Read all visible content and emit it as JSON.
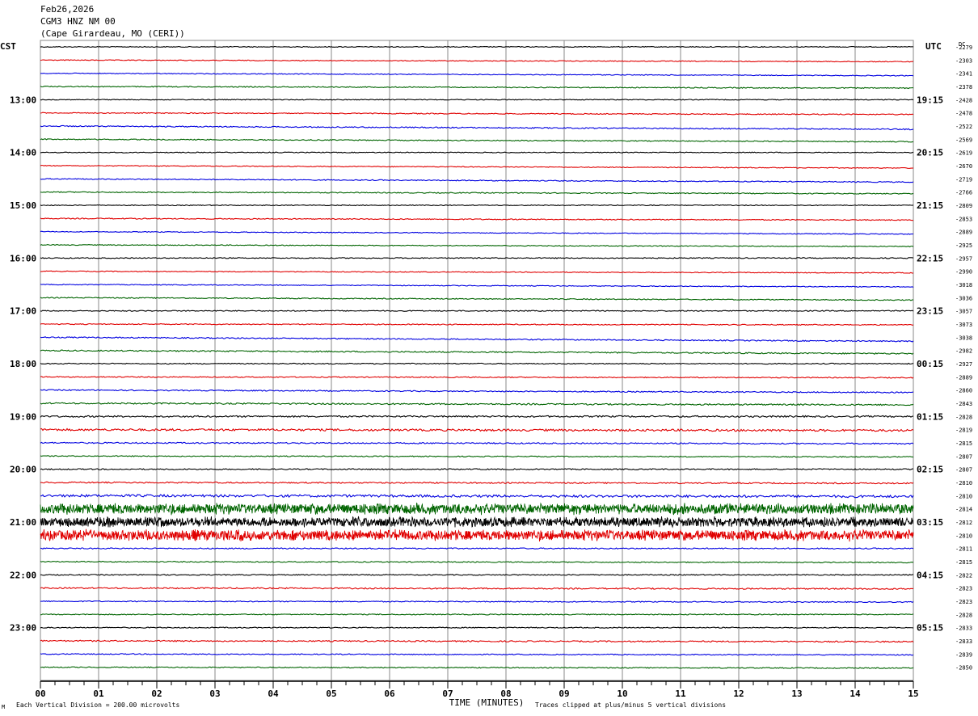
{
  "header": {
    "date": "Feb26,2026",
    "station": "CGM3 HNZ NM 00",
    "location": "(Cape Girardeau, MO (CERI))"
  },
  "left_tz": "CST",
  "right_tz": "UTC",
  "dc_label": "DC",
  "footer": {
    "scale": "Each Vertical Division =  200.00 microvolts",
    "clip": "Traces clipped at plus/minus 5 vertical divisions",
    "corner": "M"
  },
  "colors": {
    "trace": [
      "#000000",
      "#e00000",
      "#0000e0",
      "#006400"
    ],
    "grid": "#888888"
  },
  "chart_data": {
    "type": "line",
    "title": "CGM3 HNZ NM 00 (Cape Girardeau, MO (CERI))",
    "xlabel": "TIME (MINUTES)",
    "ylabel": "",
    "xlim": [
      0,
      15
    ],
    "x_ticks": [
      "00",
      "01",
      "02",
      "03",
      "04",
      "05",
      "06",
      "07",
      "08",
      "09",
      "10",
      "11",
      "12",
      "13",
      "14",
      "15"
    ],
    "rows_per_hour": 4,
    "row_minutes": 15,
    "left_hour_labels": [
      "13:00",
      "14:00",
      "15:00",
      "16:00",
      "17:00",
      "18:00",
      "19:00",
      "20:00",
      "21:00",
      "22:00",
      "23:00"
    ],
    "right_hour_labels": [
      "19:15",
      "20:15",
      "21:15",
      "22:15",
      "23:15",
      "00:15",
      "01:15",
      "02:15",
      "03:15",
      "04:15",
      "05:15"
    ],
    "dc_offsets": [
      -2279,
      -2303,
      -2341,
      -2378,
      -2428,
      -2478,
      -2522,
      -2569,
      -2619,
      -2670,
      -2719,
      -2766,
      -2809,
      -2853,
      -2889,
      -2925,
      -2957,
      -2990,
      -3018,
      -3036,
      -3057,
      -3073,
      -3038,
      -2982,
      -2927,
      -2889,
      -2860,
      -2843,
      -2828,
      -2819,
      -2815,
      -2807,
      -2807,
      -2810,
      -2810,
      -2814,
      -2812,
      -2810,
      -2811,
      -2815,
      -2822,
      -2823,
      -2823,
      -2828,
      -2833,
      -2833,
      -2839,
      -2850
    ],
    "noise_levels": [
      0.5,
      0.5,
      0.5,
      0.6,
      0.5,
      0.6,
      0.7,
      0.6,
      0.5,
      0.5,
      0.6,
      0.6,
      0.5,
      0.6,
      0.5,
      0.5,
      0.6,
      0.5,
      0.5,
      0.6,
      0.6,
      0.6,
      0.7,
      0.8,
      0.6,
      0.6,
      0.7,
      0.9,
      1.0,
      1.3,
      0.8,
      0.6,
      0.7,
      0.8,
      1.5,
      5.5,
      5.0,
      5.5,
      0.7,
      0.6,
      0.6,
      0.8,
      0.6,
      0.6,
      0.6,
      0.8,
      0.6,
      0.6
    ],
    "trend": [
      0,
      -2,
      -3,
      -2,
      0,
      -2,
      -4,
      -3,
      0,
      -3,
      -4,
      -2,
      0,
      -2,
      -3,
      -2,
      0,
      -2,
      -3,
      -3,
      0,
      -1,
      -5,
      -4,
      0,
      -1,
      -3,
      -2,
      0,
      -1,
      -1,
      -1,
      0,
      -1,
      -1,
      0,
      0,
      0,
      0,
      -1,
      0,
      -1,
      -1,
      0,
      0,
      -1,
      -1,
      -1
    ]
  }
}
